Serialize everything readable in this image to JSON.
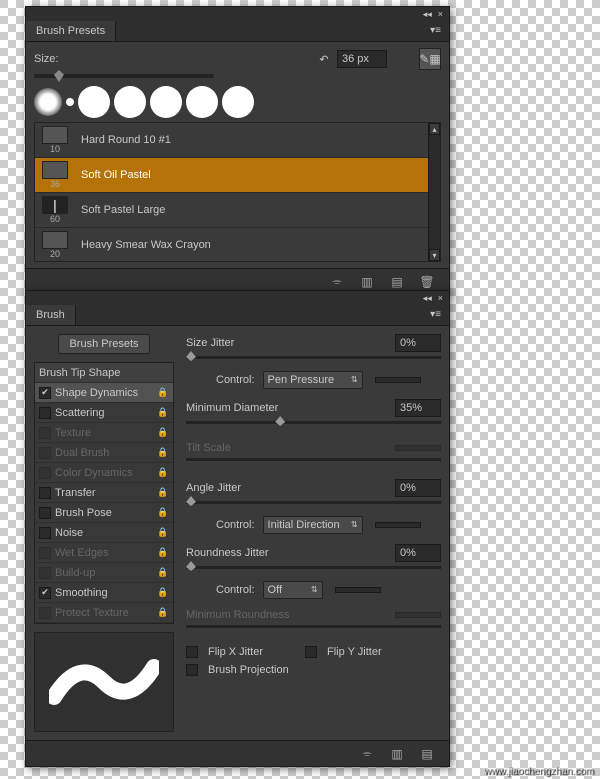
{
  "presets_panel": {
    "title": "Brush Presets",
    "size_label": "Size:",
    "size_value": "36 px",
    "brushes": [
      {
        "size": "10",
        "name": "Hard Round 10 #1"
      },
      {
        "size": "36",
        "name": "Soft Oil Pastel"
      },
      {
        "size": "60",
        "name": "Soft Pastel Large"
      },
      {
        "size": "20",
        "name": "Heavy Smear Wax Crayon"
      }
    ]
  },
  "brush_panel": {
    "title": "Brush",
    "presets_btn": "Brush Presets",
    "options": [
      {
        "label": "Brush Tip Shape",
        "header": true
      },
      {
        "label": "Shape Dynamics",
        "checked": true,
        "selected": true,
        "lock": true
      },
      {
        "label": "Scattering",
        "checked": false,
        "lock": true
      },
      {
        "label": "Texture",
        "disabled": true,
        "lock": true
      },
      {
        "label": "Dual Brush",
        "disabled": true,
        "lock": true
      },
      {
        "label": "Color Dynamics",
        "disabled": true,
        "lock": true
      },
      {
        "label": "Transfer",
        "checked": false,
        "lock": true
      },
      {
        "label": "Brush Pose",
        "checked": false,
        "lock": true
      },
      {
        "label": "Noise",
        "checked": false,
        "lock": true
      },
      {
        "label": "Wet Edges",
        "disabled": true,
        "lock": true
      },
      {
        "label": "Build-up",
        "disabled": true,
        "lock": true
      },
      {
        "label": "Smoothing",
        "checked": true,
        "lock": true
      },
      {
        "label": "Protect Texture",
        "disabled": true,
        "lock": true
      }
    ],
    "size_jitter": {
      "label": "Size Jitter",
      "value": "0%"
    },
    "control1": {
      "label": "Control:",
      "value": "Pen Pressure"
    },
    "min_diameter": {
      "label": "Minimum Diameter",
      "value": "35%"
    },
    "tilt_scale": {
      "label": "Tilt Scale"
    },
    "angle_jitter": {
      "label": "Angle Jitter",
      "value": "0%"
    },
    "control2": {
      "label": "Control:",
      "value": "Initial Direction"
    },
    "roundness_jitter": {
      "label": "Roundness Jitter",
      "value": "0%"
    },
    "control3": {
      "label": "Control:",
      "value": "Off"
    },
    "min_roundness": {
      "label": "Minimum Roundness"
    },
    "flip_x": "Flip X Jitter",
    "flip_y": "Flip Y Jitter",
    "brush_proj": "Brush Projection"
  },
  "watermark": "www.jiaochengzhan.com"
}
